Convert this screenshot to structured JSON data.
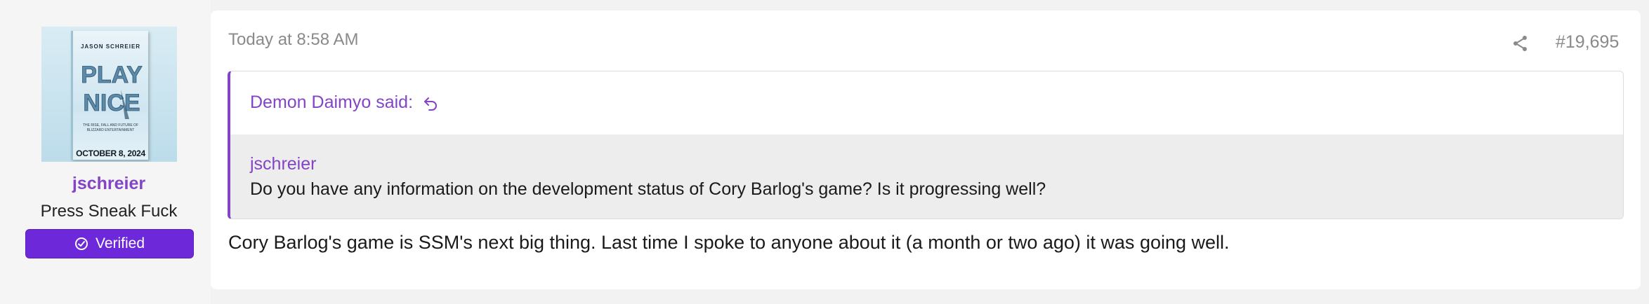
{
  "user": {
    "avatar": {
      "book_author": "JASON SCHREIER",
      "book_title": "PLAY NICE",
      "book_subtitle": "THE RISE, FALL AND FUTURE OF BLIZZARD ENTERTAINMENT",
      "book_date": "OCTOBER 8, 2024"
    },
    "username": "jschreier",
    "title": "Press Sneak Fuck",
    "badge_label": "Verified"
  },
  "post": {
    "timestamp": "Today at 8:58 AM",
    "number": "#19,695",
    "quote": {
      "attribution": "Demon Daimyo said:",
      "nested_author": "jschreier",
      "nested_text": "Do you have any information on the development status of Cory Barlog's game? Is it progressing well?"
    },
    "message": "Cory Barlog's game is SSM's next big thing. Last time I spoke to anyone about it (a month or two ago) it was going well."
  },
  "icons": {
    "share": "share-icon",
    "reply": "reply-arrow-icon",
    "verified": "check-circle-icon"
  },
  "colors": {
    "accent": "#8344c6",
    "badge": "#6d28d9",
    "quote_bg": "#ededed"
  }
}
